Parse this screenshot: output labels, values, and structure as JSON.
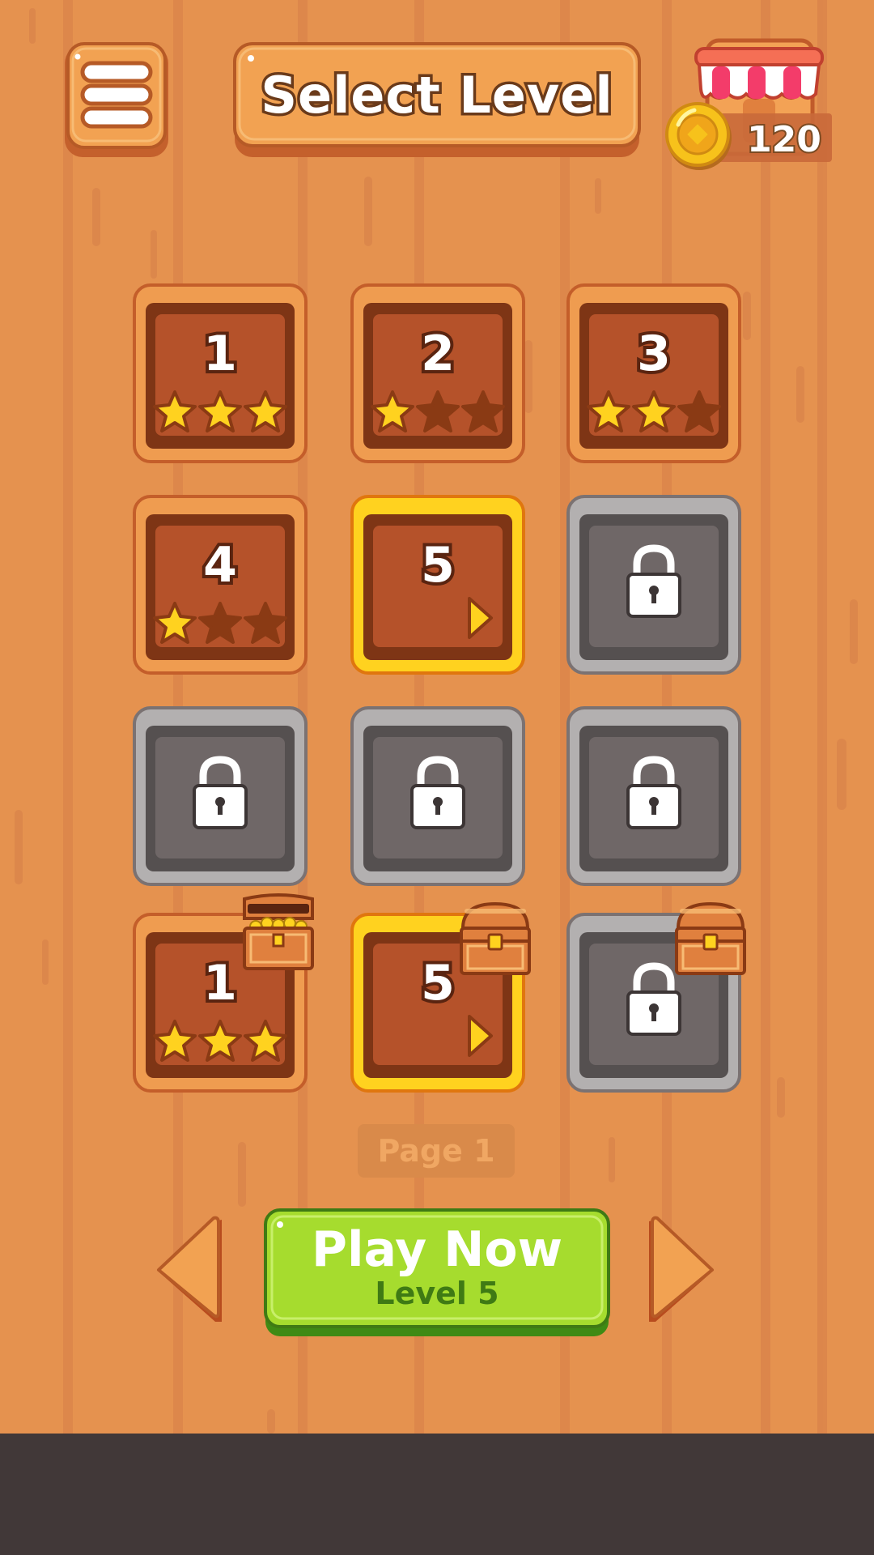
{
  "header": {
    "title": "Select Level",
    "menu_icon": "hamburger-menu-icon",
    "shop_icon": "shop-stall-icon",
    "coin_icon": "gold-coin-icon",
    "coins": "120"
  },
  "levels": [
    {
      "number": "1",
      "state": "completed",
      "stars": 3
    },
    {
      "number": "2",
      "state": "completed",
      "stars": 1
    },
    {
      "number": "3",
      "state": "completed",
      "stars": 2
    },
    {
      "number": "4",
      "state": "completed",
      "stars": 1
    },
    {
      "number": "5",
      "state": "current",
      "icon": "play-arrow-icon"
    },
    {
      "state": "locked",
      "icon": "lock-icon"
    },
    {
      "state": "locked",
      "icon": "lock-icon"
    },
    {
      "state": "locked",
      "icon": "lock-icon"
    },
    {
      "state": "locked",
      "icon": "lock-icon"
    },
    {
      "number": "1",
      "state": "completed",
      "stars": 3,
      "chest": "open-treasure-chest-icon"
    },
    {
      "number": "5",
      "state": "current",
      "icon": "play-arrow-icon",
      "chest": "closed-treasure-chest-icon"
    },
    {
      "state": "locked",
      "icon": "lock-icon",
      "chest": "closed-treasure-chest-icon"
    }
  ],
  "pager": {
    "page_label": "Page 1",
    "prev_icon": "left-arrow-icon",
    "next_icon": "right-arrow-icon"
  },
  "play": {
    "label": "Play Now",
    "sublabel": "Level 5"
  },
  "colors": {
    "background": "#e5924f",
    "tile_wood": "#b5522a",
    "tile_current_border": "#ffd21f",
    "tile_locked": "#6f6767",
    "star": "#ffd21f",
    "play_green": "#a6dc2e",
    "bottom_bar": "#413838"
  }
}
